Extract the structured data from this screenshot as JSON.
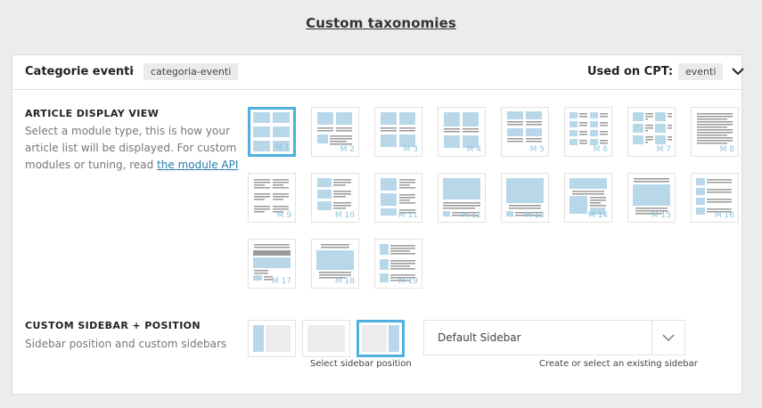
{
  "page": {
    "title": "Custom taxonomies"
  },
  "taxonomy": {
    "name": "Categorie eventi",
    "arrow": "›",
    "slug": "categoria-eventi",
    "cpt_label": "Used on CPT:",
    "cpt_value": "eventi"
  },
  "article_view": {
    "title": "ARTICLE DISPLAY VIEW",
    "desc_1": "Select a module type, this is how your",
    "desc_2": "article list will be displayed. For custom",
    "desc_3": "modules or tuning, read",
    "link": "the module API",
    "modules": [
      "M 1",
      "M 2",
      "M 3",
      "M 4",
      "M 5",
      "M 6",
      "M 7",
      "M 8",
      "M 9",
      "M 10",
      "M 11",
      "M 12",
      "M 13",
      "M 14",
      "M 15",
      "M 16",
      "M 17",
      "M 18",
      "M 19"
    ],
    "selected": "M 1"
  },
  "sidebar": {
    "title": "CUSTOM SIDEBAR + POSITION",
    "desc": "Sidebar position and custom sidebars",
    "position_caption": "Select sidebar position",
    "select_value": "Default Sidebar",
    "select_caption": "Create or select an existing sidebar"
  },
  "colors": {
    "accent": "#4eb0e0",
    "thumb_blue": "#b8d8ea",
    "thumb_gray": "#9a9a9a",
    "link": "#2a7ca8"
  }
}
